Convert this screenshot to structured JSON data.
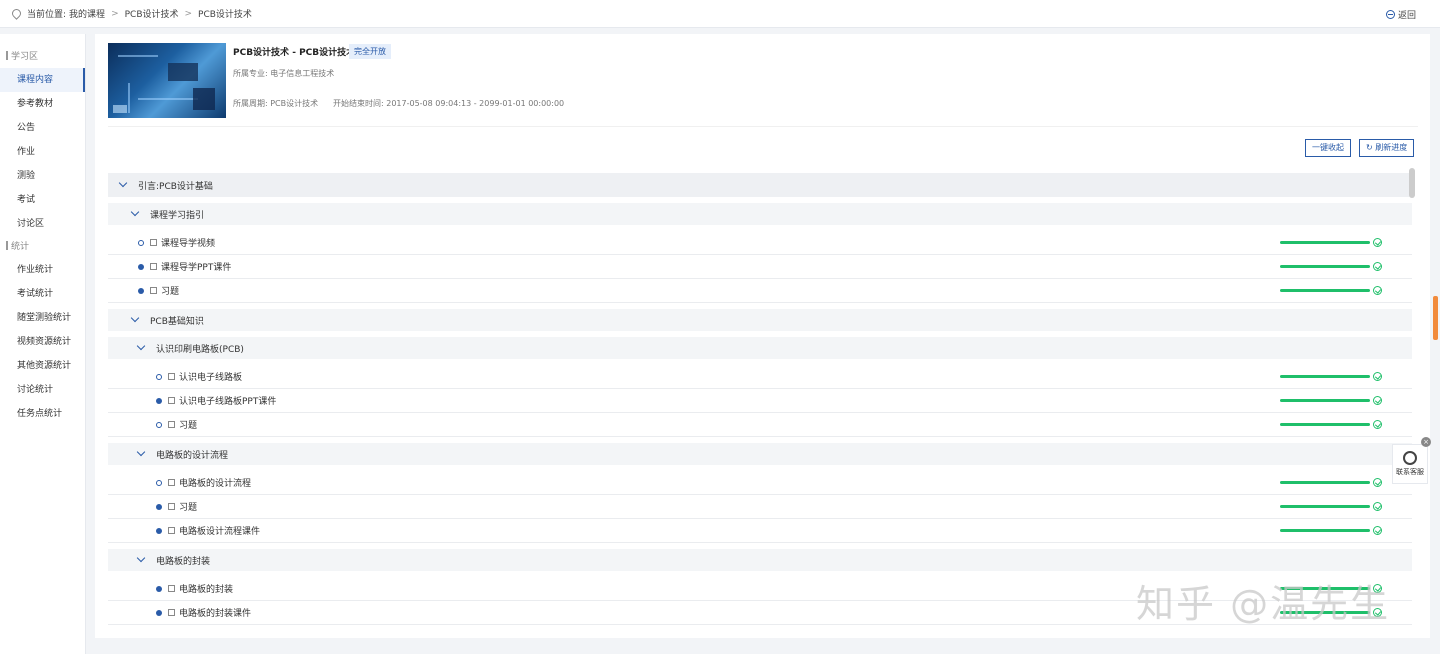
{
  "breadcrumb": {
    "prefix": "当前位置:",
    "items": [
      "我的课程",
      "PCB设计技术",
      "PCB设计技术"
    ]
  },
  "back_label": "返回",
  "sidebar": {
    "groups": [
      {
        "label": "学习区",
        "items": [
          "课程内容",
          "参考教材",
          "公告",
          "作业",
          "测验",
          "考试",
          "讨论区"
        ]
      },
      {
        "label": "统计",
        "items": [
          "作业统计",
          "考试统计",
          "随堂测验统计",
          "视频资源统计",
          "其他资源统计",
          "讨论统计",
          "任务点统计"
        ]
      }
    ],
    "active": "课程内容"
  },
  "course": {
    "title": "PCB设计技术 - PCB设计技术",
    "badge": "完全开放",
    "major": "所属专业: 电子信息工程技术",
    "term": "所属周期: PCB设计技术",
    "time": "开始结束时间: 2017-05-08 09:04:13 - 2099-01-01 00:00:00"
  },
  "buttons": {
    "collapse": "一键收起",
    "refresh": "刷新进度"
  },
  "rows": [
    {
      "level": 1,
      "type": "h1",
      "title": "引言:PCB设计基础"
    },
    {
      "level": 2,
      "type": "h2",
      "title": "课程学习指引"
    },
    {
      "level": 3,
      "type": "leaf",
      "dot": "o",
      "title": "课程导学视频",
      "progress": 1.0
    },
    {
      "level": 3,
      "type": "leaf",
      "dot": "f",
      "title": "课程导学PPT课件",
      "progress": 1.0
    },
    {
      "level": 3,
      "type": "leaf",
      "dot": "f",
      "title": "习题",
      "progress": 1.0
    },
    {
      "level": 2,
      "type": "h2",
      "title": "PCB基础知识"
    },
    {
      "level": 3,
      "type": "h2",
      "title": "认识印刷电路板(PCB)"
    },
    {
      "level": 4,
      "type": "leaf",
      "dot": "o",
      "title": "认识电子线路板",
      "progress": 1.0
    },
    {
      "level": 4,
      "type": "leaf",
      "dot": "f",
      "title": "认识电子线路板PPT课件",
      "progress": 1.0
    },
    {
      "level": 4,
      "type": "leaf",
      "dot": "o",
      "title": "习题",
      "progress": 1.0
    },
    {
      "level": 3,
      "type": "h2",
      "title": "电路板的设计流程"
    },
    {
      "level": 4,
      "type": "leaf",
      "dot": "o",
      "title": "电路板的设计流程",
      "progress": 1.0
    },
    {
      "level": 4,
      "type": "leaf",
      "dot": "f",
      "title": "习题",
      "progress": 1.0
    },
    {
      "level": 4,
      "type": "leaf",
      "dot": "f",
      "title": "电路板设计流程课件",
      "progress": 1.0
    },
    {
      "level": 3,
      "type": "h2",
      "title": "电路板的封装"
    },
    {
      "level": 4,
      "type": "leaf",
      "dot": "f",
      "title": "电路板的封装",
      "progress": 1.0
    },
    {
      "level": 4,
      "type": "leaf",
      "dot": "f",
      "title": "电路板的封装课件",
      "progress": 1.0
    }
  ],
  "service_label": "联系客服",
  "watermark": "知乎 @温先生",
  "colors": {
    "accent": "#2a5ba8",
    "progress": "#1fbf6a"
  }
}
